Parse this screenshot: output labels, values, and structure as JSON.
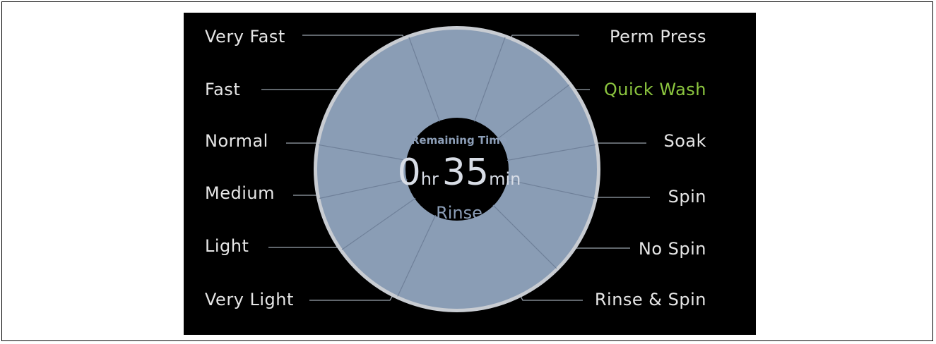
{
  "left_options": [
    {
      "label": "Very Fast",
      "selected": false
    },
    {
      "label": "Fast",
      "selected": false
    },
    {
      "label": "Normal",
      "selected": false
    },
    {
      "label": "Medium",
      "selected": false
    },
    {
      "label": "Light",
      "selected": false
    },
    {
      "label": "Very Light",
      "selected": false
    }
  ],
  "right_options": [
    {
      "label": "Perm Press",
      "selected": false
    },
    {
      "label": "Quick Wash",
      "selected": true
    },
    {
      "label": "Soak",
      "selected": false
    },
    {
      "label": "Spin",
      "selected": false
    },
    {
      "label": "No Spin",
      "selected": false
    },
    {
      "label": "Rinse & Spin",
      "selected": false
    }
  ],
  "status": {
    "remaining_label": "Remaining Time",
    "hours": "0",
    "hours_unit": "hr",
    "minutes": "35",
    "minutes_unit": "min",
    "phase": "Rinse"
  },
  "colors": {
    "selected": "#8cc63f",
    "option_text": "#e6e6e6",
    "dial_ring": "#8a9db5",
    "dial_rim": "#c8ccd2",
    "panel_background": "#000000"
  }
}
